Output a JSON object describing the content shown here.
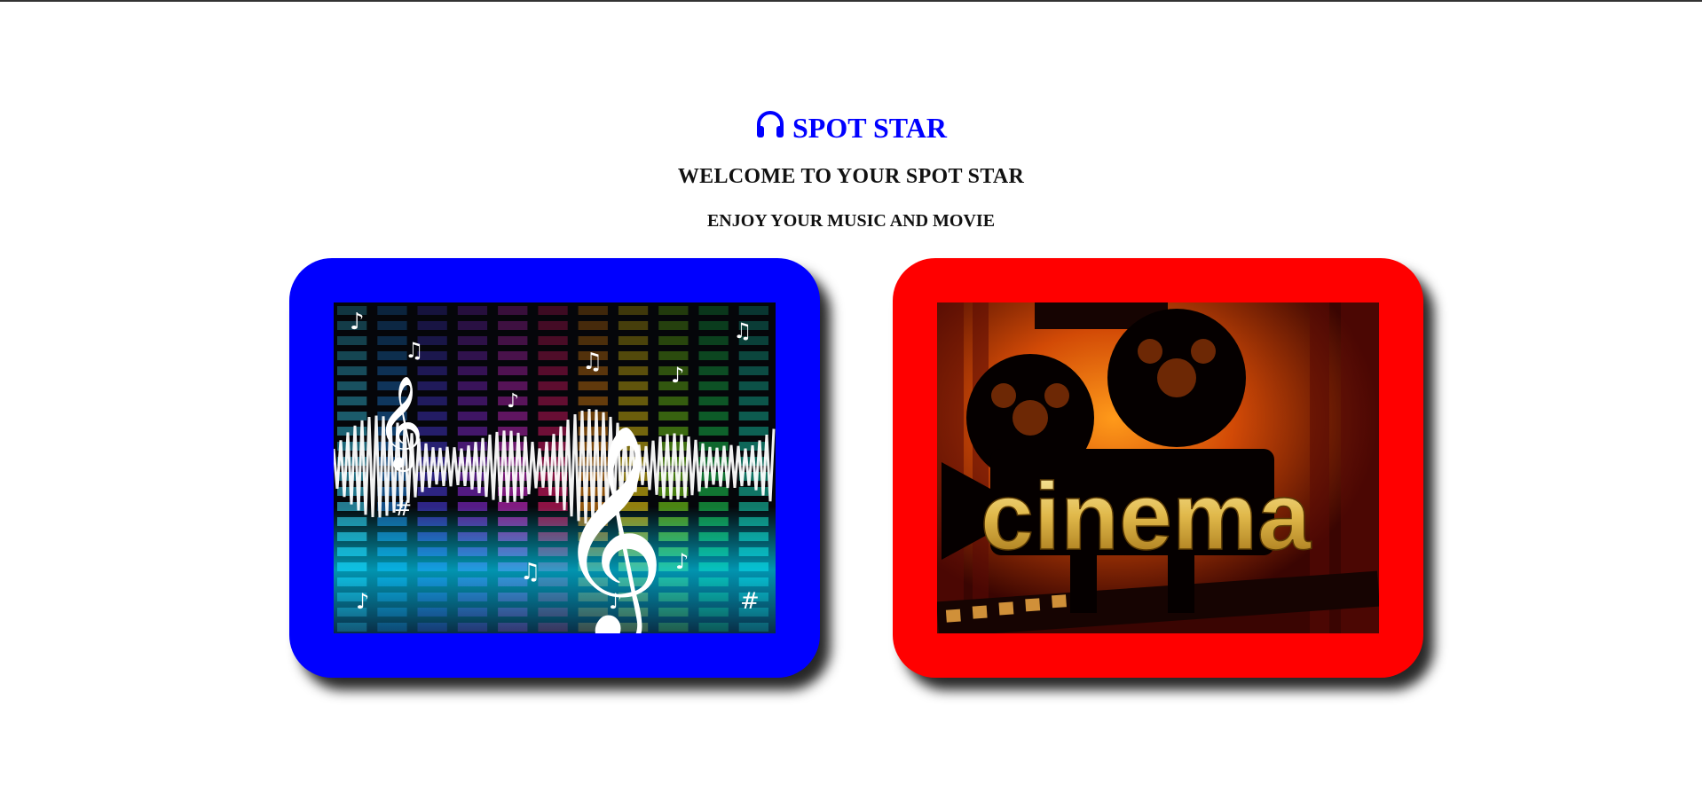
{
  "brand": {
    "icon": "headphones-icon",
    "title": "SPOT STAR",
    "color": "#0000ff"
  },
  "welcome": "WELCOME TO YOUR SPOT STAR",
  "tagline": "ENJOY YOUR MUSIC AND MOVIE",
  "cards": {
    "music": {
      "border_color": "#0000ff",
      "image": "music-equalizer-image"
    },
    "movie": {
      "border_color": "#ff0000",
      "image": "cinema-projector-image",
      "image_text": "cinema"
    }
  }
}
